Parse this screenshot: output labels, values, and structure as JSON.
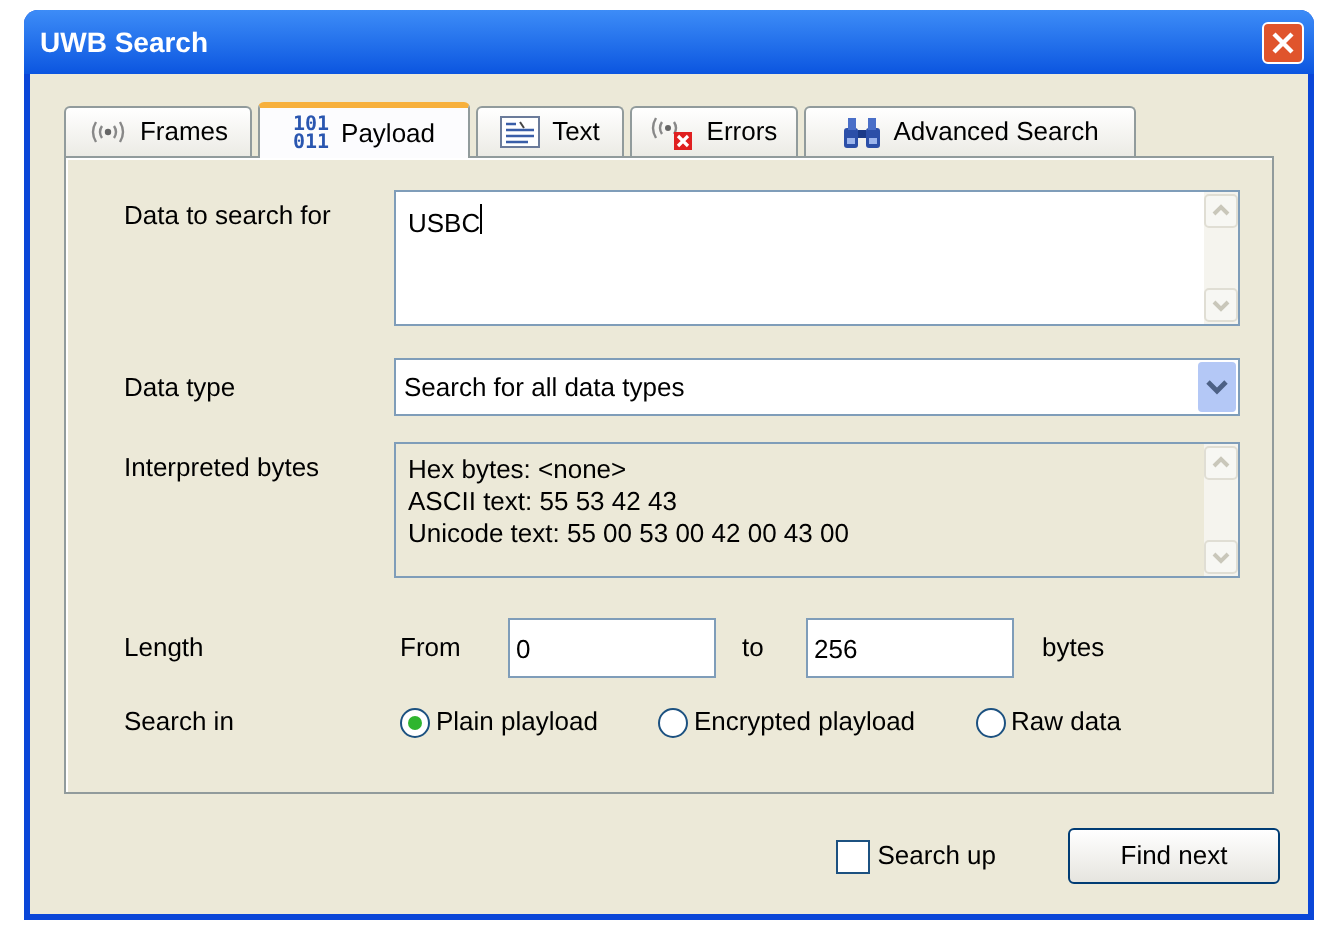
{
  "window": {
    "title": "UWB Search"
  },
  "tabs": [
    {
      "kind": "frames",
      "label": "Frames",
      "selected": false
    },
    {
      "kind": "payload",
      "label": "Payload",
      "icon_text": [
        "101",
        "011"
      ],
      "selected": true
    },
    {
      "kind": "text",
      "label": "Text",
      "selected": false
    },
    {
      "kind": "errors",
      "label": "Errors",
      "selected": false
    },
    {
      "kind": "advanced",
      "label": "Advanced Search",
      "selected": false
    }
  ],
  "data_to_search": {
    "label": "Data to search for",
    "value": "USBC"
  },
  "data_type": {
    "label": "Data type",
    "value": "Search for all data types"
  },
  "interpreted_bytes": {
    "label": "Interpreted bytes",
    "lines": [
      "Hex bytes: <none>",
      "ASCII text: 55 53 42 43",
      "Unicode text: 55 00 53 00 42 00 43 00"
    ]
  },
  "length": {
    "label": "Length",
    "from_label": "From",
    "from_value": "0",
    "to_label": "to",
    "to_value": "256",
    "unit": "bytes"
  },
  "search_in": {
    "label": "Search in",
    "options": [
      {
        "label": "Plain playload",
        "selected": true
      },
      {
        "label": "Encrypted playload",
        "selected": false
      },
      {
        "label": "Raw data",
        "selected": false
      }
    ]
  },
  "search_up": {
    "label": "Search up",
    "checked": false
  },
  "find_button": {
    "label": "Find next"
  }
}
